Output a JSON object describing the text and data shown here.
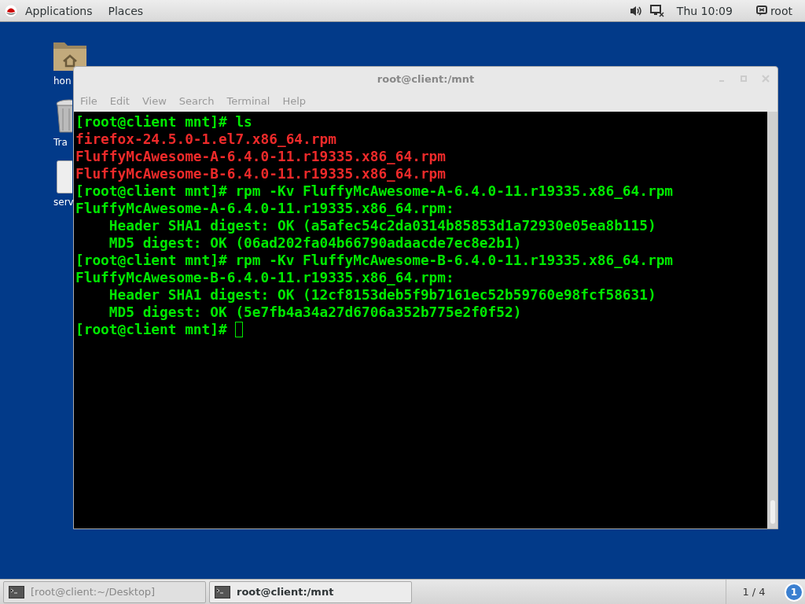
{
  "top_bar": {
    "menus": [
      "Applications",
      "Places"
    ],
    "clock": "Thu 10:09",
    "user": "root"
  },
  "desktop_icons": [
    {
      "kind": "folder",
      "label": "hon"
    },
    {
      "kind": "trash",
      "label": "Tra"
    },
    {
      "kind": "file",
      "label": "serv"
    }
  ],
  "terminal_window": {
    "title": "root@client:/mnt",
    "menus": [
      "File",
      "Edit",
      "View",
      "Search",
      "Terminal",
      "Help"
    ],
    "lines": [
      {
        "kind": "prompt",
        "prompt": "[root@client mnt]#",
        "command": "ls"
      },
      {
        "kind": "file",
        "text": "firefox-24.5.0-1.el7.x86_64.rpm"
      },
      {
        "kind": "file",
        "text": "FluffyMcAwesome-A-6.4.0-11.r19335.x86_64.rpm"
      },
      {
        "kind": "file",
        "text": "FluffyMcAwesome-B-6.4.0-11.r19335.x86_64.rpm"
      },
      {
        "kind": "prompt",
        "prompt": "[root@client mnt]#",
        "command": "rpm -Kv FluffyMcAwesome-A-6.4.0-11.r19335.x86_64.rpm"
      },
      {
        "kind": "output",
        "text": "FluffyMcAwesome-A-6.4.0-11.r19335.x86_64.rpm:"
      },
      {
        "kind": "output",
        "text": "    Header SHA1 digest: OK (a5afec54c2da0314b85853d1a72930e05ea8b115)"
      },
      {
        "kind": "output",
        "text": "    MD5 digest: OK (06ad202fa04b66790adaacde7ec8e2b1)"
      },
      {
        "kind": "prompt",
        "prompt": "[root@client mnt]#",
        "command": "rpm -Kv FluffyMcAwesome-B-6.4.0-11.r19335.x86_64.rpm"
      },
      {
        "kind": "output",
        "text": "FluffyMcAwesome-B-6.4.0-11.r19335.x86_64.rpm:"
      },
      {
        "kind": "output",
        "text": "    Header SHA1 digest: OK (12cf8153deb5f9b7161ec52b59760e98fcf58631)"
      },
      {
        "kind": "output",
        "text": "    MD5 digest: OK (5e7fb4a34a27d6706a352b775e2f0f52)"
      },
      {
        "kind": "prompt",
        "prompt": "[root@client mnt]#",
        "cursor": true
      }
    ]
  },
  "taskbar": {
    "tasks": [
      {
        "label": "[root@client:~/Desktop]",
        "selected": false
      },
      {
        "label": "root@client:/mnt",
        "selected": true
      }
    ],
    "workspace": "1 / 4",
    "notifications": "1"
  }
}
